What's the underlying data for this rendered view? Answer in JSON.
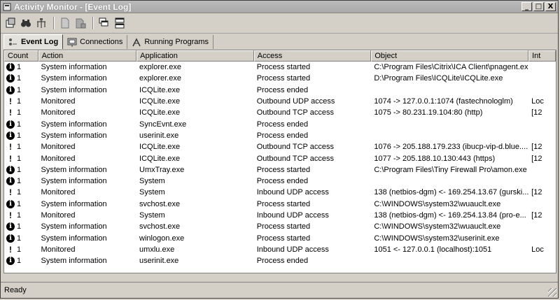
{
  "window": {
    "title": "Activity Monitor - [Event Log]"
  },
  "window_buttons": {
    "minimize": "_",
    "maximize": "□",
    "close": "X"
  },
  "toolbar": {
    "icons": [
      "properties-icon",
      "find-icon",
      "network-icon",
      "document-icon",
      "document-stack-icon",
      "window-cascade-icon",
      "window-tile-icon"
    ]
  },
  "tabs": [
    {
      "label": "Event Log",
      "active": true
    },
    {
      "label": "Connections",
      "active": false
    },
    {
      "label": "Running Programs",
      "active": false
    }
  ],
  "columns": [
    "Count",
    "Action",
    "Application",
    "Access",
    "Object",
    "Int"
  ],
  "rows": [
    {
      "type": "info",
      "count": "1",
      "action": "System information",
      "application": "explorer.exe",
      "access": "Process started",
      "object": "C:\\Program Files\\Citrix\\ICA Client\\pnagent.exe",
      "int": ""
    },
    {
      "type": "info",
      "count": "1",
      "action": "System information",
      "application": "explorer.exe",
      "access": "Process started",
      "object": "D:\\Program Files\\ICQLite\\ICQLite.exe",
      "int": ""
    },
    {
      "type": "info",
      "count": "1",
      "action": "System information",
      "application": "ICQLite.exe",
      "access": "Process ended",
      "object": "",
      "int": ""
    },
    {
      "type": "warn",
      "count": "1",
      "action": "Monitored",
      "application": "ICQLite.exe",
      "access": "Outbound UDP access",
      "object": "1074 -> 127.0.0.1:1074 (fastechnologlm)",
      "int": "Loc"
    },
    {
      "type": "warn",
      "count": "1",
      "action": "Monitored",
      "application": "ICQLite.exe",
      "access": "Outbound TCP access",
      "object": "1075 -> 80.231.19.104:80 (http)",
      "int": "[12"
    },
    {
      "type": "info",
      "count": "1",
      "action": "System information",
      "application": "SyncEvnt.exe",
      "access": "Process ended",
      "object": "",
      "int": ""
    },
    {
      "type": "info",
      "count": "1",
      "action": "System information",
      "application": "userinit.exe",
      "access": "Process ended",
      "object": "",
      "int": ""
    },
    {
      "type": "warn",
      "count": "1",
      "action": "Monitored",
      "application": "ICQLite.exe",
      "access": "Outbound TCP access",
      "object": "1076 -> 205.188.179.233 (ibucp-vip-d.blue....",
      "int": "[12"
    },
    {
      "type": "warn",
      "count": "1",
      "action": "Monitored",
      "application": "ICQLite.exe",
      "access": "Outbound TCP access",
      "object": "1077 -> 205.188.10.130:443 (https)",
      "int": "[12"
    },
    {
      "type": "info",
      "count": "1",
      "action": "System information",
      "application": "UmxTray.exe",
      "access": "Process started",
      "object": "C:\\Program Files\\Tiny Firewall Pro\\amon.exe",
      "int": ""
    },
    {
      "type": "info",
      "count": "1",
      "action": "System information",
      "application": "System",
      "access": "Process ended",
      "object": "",
      "int": ""
    },
    {
      "type": "warn",
      "count": "1",
      "action": "Monitored",
      "application": "System",
      "access": "Inbound UDP access",
      "object": "138 (netbios-dgm) <- 169.254.13.67 (gurski...",
      "int": "[12"
    },
    {
      "type": "info",
      "count": "1",
      "action": "System information",
      "application": "svchost.exe",
      "access": "Process started",
      "object": "C:\\WINDOWS\\system32\\wuauclt.exe",
      "int": ""
    },
    {
      "type": "warn",
      "count": "1",
      "action": "Monitored",
      "application": "System",
      "access": "Inbound UDP access",
      "object": "138 (netbios-dgm) <- 169.254.13.84 (pro-e...",
      "int": "[12"
    },
    {
      "type": "info",
      "count": "1",
      "action": "System information",
      "application": "svchost.exe",
      "access": "Process started",
      "object": "C:\\WINDOWS\\system32\\wuauclt.exe",
      "int": ""
    },
    {
      "type": "info",
      "count": "1",
      "action": "System information",
      "application": "winlogon.exe",
      "access": "Process started",
      "object": "C:\\WINDOWS\\system32\\userinit.exe",
      "int": ""
    },
    {
      "type": "warn",
      "count": "1",
      "action": "Monitored",
      "application": "umxlu.exe",
      "access": "Inbound UDP access",
      "object": "1051 <- 127.0.0.1 (localhost):1051",
      "int": "Loc"
    },
    {
      "type": "info",
      "count": "1",
      "action": "System information",
      "application": "userinit.exe",
      "access": "Process ended",
      "object": "",
      "int": ""
    }
  ],
  "status": {
    "text": "Ready"
  }
}
